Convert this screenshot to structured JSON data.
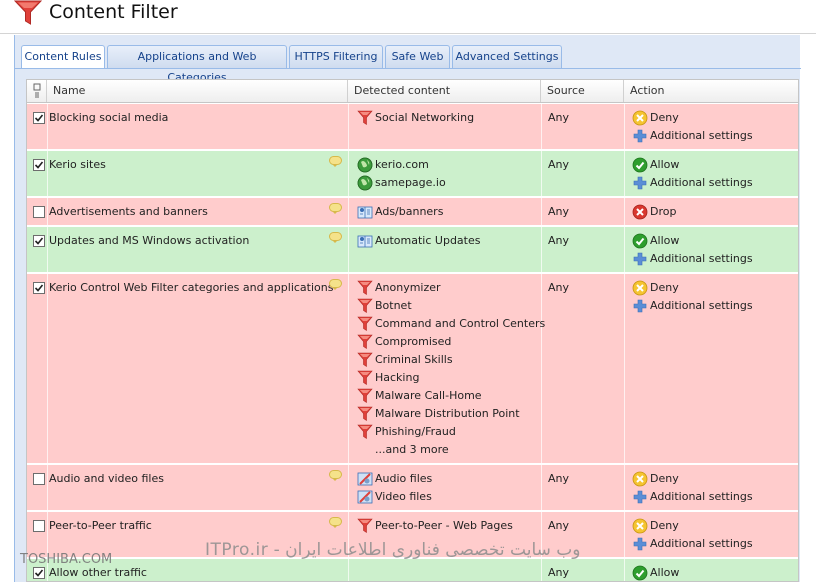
{
  "app": {
    "title": "Content Filter"
  },
  "tabs": [
    {
      "label": "Content Rules"
    },
    {
      "label": "Applications and Web Categories"
    },
    {
      "label": "HTTPS Filtering"
    },
    {
      "label": "Safe Web"
    },
    {
      "label": "Advanced Settings"
    }
  ],
  "grid": {
    "columns": {
      "name": "Name",
      "detected": "Detected content",
      "source": "Source",
      "action": "Action"
    },
    "rows": [
      {
        "checked": true,
        "name": "Blocking social media",
        "comment": false,
        "status": "deny",
        "detected": [
          {
            "icon": "filter-icon",
            "text": "Social Networking"
          }
        ],
        "source": "Any",
        "actions": [
          {
            "icon": "deny-icon",
            "text": "Deny"
          },
          {
            "icon": "plus-icon",
            "text": "Additional settings"
          }
        ]
      },
      {
        "checked": true,
        "name": "Kerio sites",
        "comment": true,
        "status": "allow",
        "detected": [
          {
            "icon": "globe-icon",
            "text": "kerio.com"
          },
          {
            "icon": "globe-icon",
            "text": "samepage.io"
          }
        ],
        "source": "Any",
        "actions": [
          {
            "icon": "allow-icon",
            "text": "Allow"
          },
          {
            "icon": "plus-icon",
            "text": "Additional settings"
          }
        ]
      },
      {
        "checked": false,
        "name": "Advertisements and banners",
        "comment": true,
        "status": "drop",
        "detected": [
          {
            "icon": "book-icon",
            "text": "Ads/banners"
          }
        ],
        "source": "Any",
        "actions": [
          {
            "icon": "drop-icon",
            "text": "Drop"
          }
        ]
      },
      {
        "checked": true,
        "name": "Updates and MS Windows activation",
        "comment": true,
        "status": "allow",
        "detected": [
          {
            "icon": "book-icon",
            "text": "Automatic Updates"
          }
        ],
        "source": "Any",
        "actions": [
          {
            "icon": "allow-icon",
            "text": "Allow"
          },
          {
            "icon": "plus-icon",
            "text": "Additional settings"
          }
        ]
      },
      {
        "checked": true,
        "name": "Kerio Control Web Filter categories and applications",
        "comment": true,
        "status": "deny",
        "detected": [
          {
            "icon": "filter-icon",
            "text": "Anonymizer"
          },
          {
            "icon": "filter-icon",
            "text": "Botnet"
          },
          {
            "icon": "filter-icon",
            "text": "Command and Control Centers"
          },
          {
            "icon": "filter-icon",
            "text": "Compromised"
          },
          {
            "icon": "filter-icon",
            "text": "Criminal Skills"
          },
          {
            "icon": "filter-icon",
            "text": "Hacking"
          },
          {
            "icon": "filter-icon",
            "text": "Malware Call-Home"
          },
          {
            "icon": "filter-icon",
            "text": "Malware Distribution Point"
          },
          {
            "icon": "filter-icon",
            "text": "Phishing/Fraud"
          },
          {
            "icon": "",
            "text": "...and 3 more"
          }
        ],
        "source": "Any",
        "actions": [
          {
            "icon": "deny-icon",
            "text": "Deny"
          },
          {
            "icon": "plus-icon",
            "text": "Additional settings"
          }
        ]
      },
      {
        "checked": false,
        "name": "Audio and video files",
        "comment": true,
        "status": "deny",
        "detected": [
          {
            "icon": "media-icon",
            "text": "Audio files"
          },
          {
            "icon": "media-icon",
            "text": "Video files"
          }
        ],
        "source": "Any",
        "actions": [
          {
            "icon": "deny-icon",
            "text": "Deny"
          },
          {
            "icon": "plus-icon",
            "text": "Additional settings"
          }
        ]
      },
      {
        "checked": false,
        "name": "Peer-to-Peer traffic",
        "comment": true,
        "status": "deny",
        "detected": [
          {
            "icon": "filter-icon",
            "text": "Peer-to-Peer - Web Pages"
          }
        ],
        "source": "Any",
        "actions": [
          {
            "icon": "deny-icon",
            "text": "Deny"
          },
          {
            "icon": "plus-icon",
            "text": "Additional settings"
          }
        ]
      },
      {
        "checked": true,
        "name": "Allow other traffic",
        "comment": false,
        "status": "allow",
        "detected": [],
        "source": "Any",
        "actions": [
          {
            "icon": "allow-icon",
            "text": "Allow"
          }
        ]
      }
    ]
  },
  "watermark": {
    "text": "وب سایت تخصصی فناوری اطلاعات ایران - ITPro.ir",
    "corner": "TOSHIBA.COM"
  },
  "colors": {
    "deny_row": "#ffcccc",
    "allow_row": "#ccf0cc",
    "tab_text": "#15428b",
    "filter_red": "#e0403a"
  }
}
